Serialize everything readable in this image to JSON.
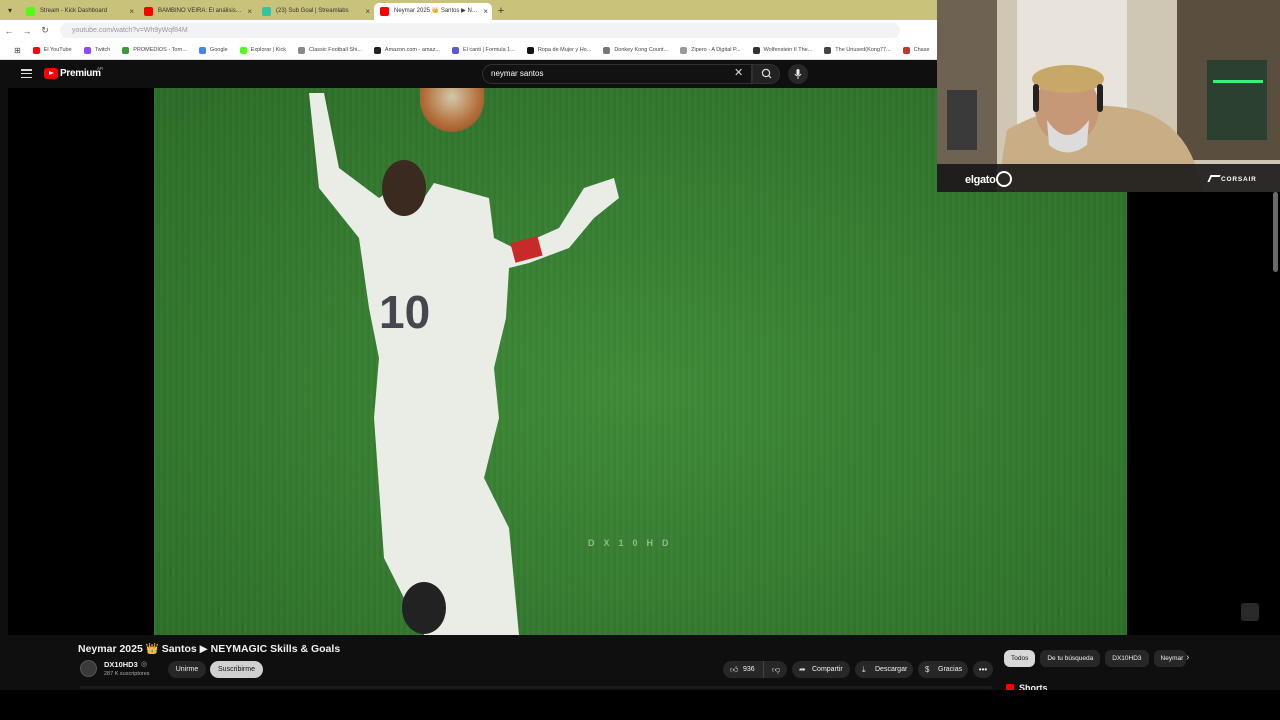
{
  "browser": {
    "tabs": [
      {
        "label": "Stream - Kick Dashboard",
        "favicon_color": "#53fc18",
        "active": false
      },
      {
        "label": "BAMBINO VEIRA: El análisis d...",
        "favicon_color": "#ff0000",
        "active": false
      },
      {
        "label": "(23) Sub Goal | Streamlabs",
        "favicon_color": "#31c3a2",
        "active": false
      },
      {
        "label": "Neymar 2025 👑 Santos ▶ NE...",
        "favicon_color": "#ff0000",
        "active": true
      }
    ],
    "url": "youtube.com/watch?v=Wh9yWqf84M",
    "bookmarks": [
      {
        "label": "El YouTube",
        "color": "#ff0000"
      },
      {
        "label": "Twitch",
        "color": "#9146ff"
      },
      {
        "label": "PROMEDIOS - Torn...",
        "color": "#3a9a3a"
      },
      {
        "label": "Google",
        "color": "#4285f4"
      },
      {
        "label": "Explorar | Kick",
        "color": "#53fc18"
      },
      {
        "label": "Classic Football Shi...",
        "color": "#888888"
      },
      {
        "label": "Amazon.com - amaz...",
        "color": "#222222"
      },
      {
        "label": "El canti | Formula 1...",
        "color": "#5a5ad8"
      },
      {
        "label": "Ropa de Mujer y Ho...",
        "color": "#111111"
      },
      {
        "label": "Donkey Kong Count...",
        "color": "#777777"
      },
      {
        "label": "Zipero - A Digital P...",
        "color": "#999999"
      },
      {
        "label": "Wolfenstein II The...",
        "color": "#333333"
      },
      {
        "label": "The Unused(Kong77...",
        "color": "#444444"
      },
      {
        "label": "Chase",
        "color": "#c0392b"
      }
    ]
  },
  "youtube": {
    "brand": "Premium",
    "country": "AR",
    "search_query": "neymar santos",
    "video_watermark": "DX10HD",
    "video_title": "Neymar 2025 👑 Santos ▶ NEYMAGIC Skills & Goals",
    "channel_name": "DX10HD3",
    "channel_verified": "◎",
    "channel_subs": "287 K suscriptores",
    "join_label": "Unirme",
    "subscribe_label": "Suscribirme",
    "like_count": "936",
    "share_label": "Compartir",
    "download_label": "Descargar",
    "thanks_label": "Gracias",
    "chips": [
      "Todos",
      "De tu búsqueda",
      "DX10HD3",
      "Neymar"
    ],
    "shorts_label": "Shorts"
  },
  "webcam": {
    "brand_left": "elgato",
    "brand_right": "CORSAIR"
  }
}
